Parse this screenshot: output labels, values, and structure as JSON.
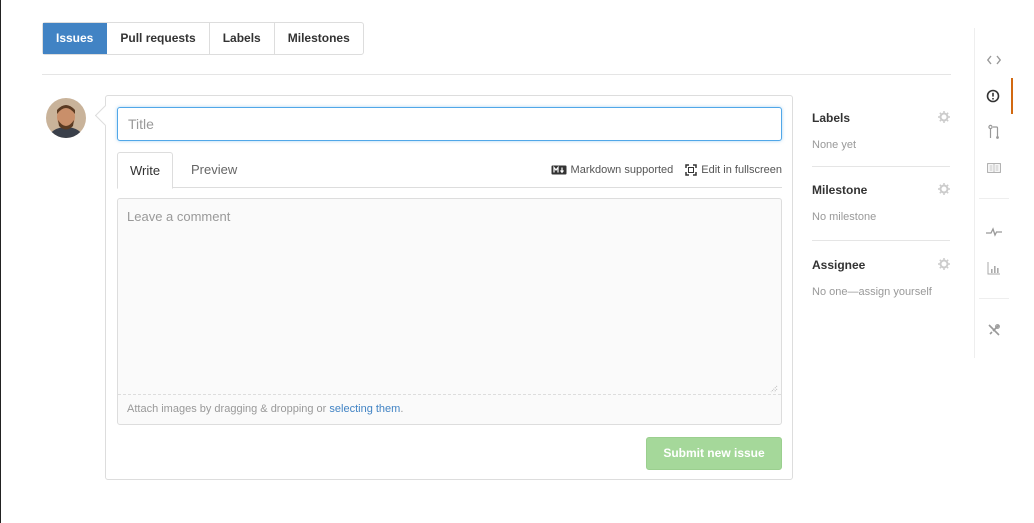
{
  "tabs": [
    {
      "label": "Issues",
      "active": true
    },
    {
      "label": "Pull requests",
      "active": false
    },
    {
      "label": "Labels",
      "active": false
    },
    {
      "label": "Milestones",
      "active": false
    }
  ],
  "form": {
    "title_placeholder": "Title",
    "write_tab": "Write",
    "preview_tab": "Preview",
    "markdown_label": "Markdown supported",
    "fullscreen_label": "Edit in fullscreen",
    "comment_placeholder": "Leave a comment",
    "attach_text": "Attach images by dragging & dropping or ",
    "attach_link": "selecting them",
    "attach_end": ".",
    "submit_label": "Submit new issue"
  },
  "sidebar": {
    "labels": {
      "heading": "Labels",
      "value": "None yet"
    },
    "milestone": {
      "heading": "Milestone",
      "value": "No milestone"
    },
    "assignee": {
      "heading": "Assignee",
      "value": "No one—assign yourself"
    }
  },
  "rail_icons": [
    "code-icon",
    "issues-icon",
    "pull-request-icon",
    "wiki-icon",
    "pulse-icon",
    "graphs-icon",
    "settings-icon"
  ],
  "colors": {
    "accent": "#4183c4",
    "submit_disabled": "#a5d89a",
    "active_rail": "#d26911"
  }
}
